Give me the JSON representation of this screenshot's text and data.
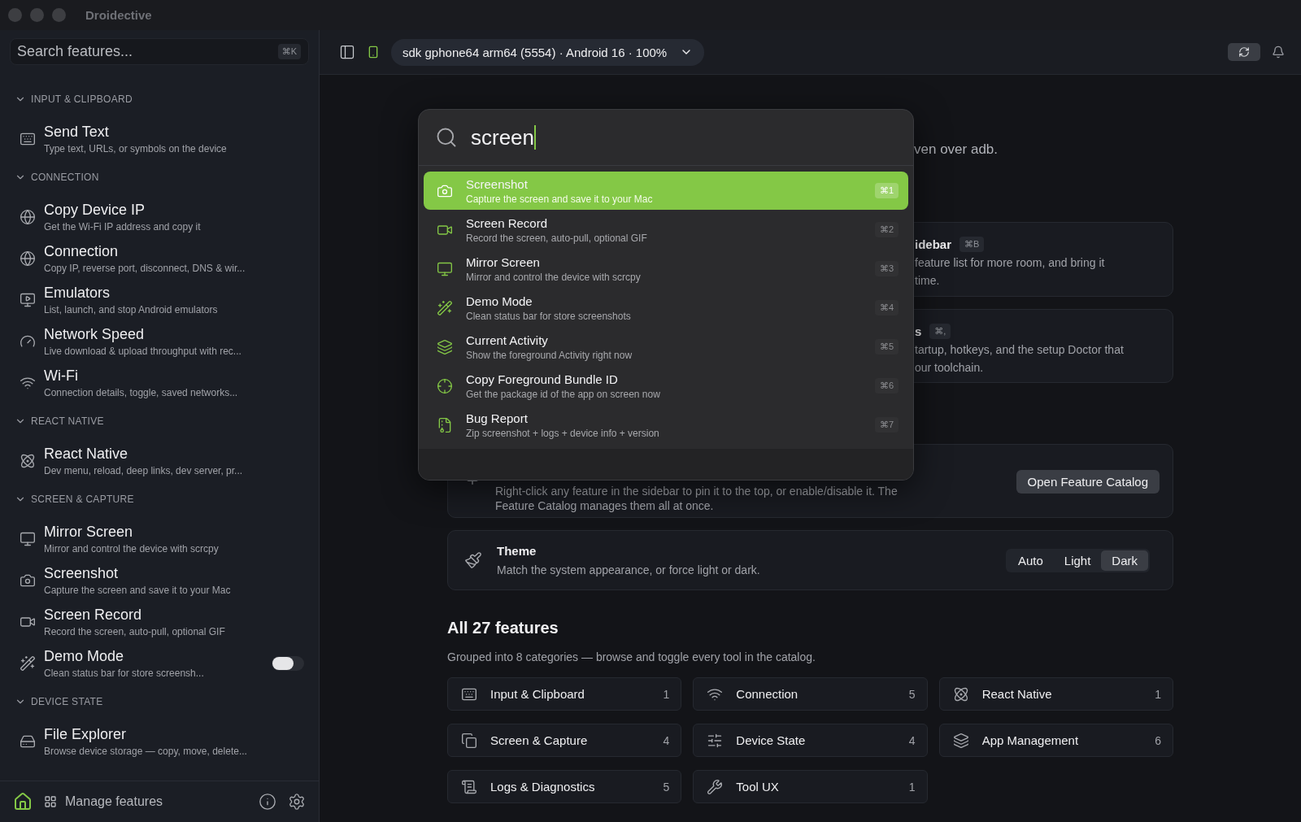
{
  "window": {
    "title": "Droidective"
  },
  "sidebar": {
    "search": {
      "placeholder": "Search features...",
      "shortcut": "⌘K"
    },
    "sections": [
      {
        "title": "INPUT & CLIPBOARD",
        "expanded": true,
        "items": [
          {
            "kind": "plain",
            "title": "Send Text",
            "description": "Type text, URLs, or symbols on the device"
          }
        ]
      },
      {
        "title": "CONNECTION",
        "expanded": true,
        "items": [
          {
            "kind": "plain",
            "title": "Copy Device IP",
            "description": "Get the Wi-Fi IP address and copy it"
          },
          {
            "kind": "plain",
            "title": "Connection",
            "description": "Copy IP, reverse port, disconnect, DNS & wir..."
          },
          {
            "kind": "plain",
            "title": "Emulators",
            "description": "List, launch, and stop Android emulators"
          },
          {
            "kind": "plain",
            "title": "Network Speed",
            "description": "Live download & upload throughput with rec..."
          },
          {
            "kind": "plain",
            "title": "Wi-Fi",
            "description": "Connection details, toggle, saved networks..."
          }
        ]
      },
      {
        "title": "REACT NATIVE",
        "expanded": true,
        "items": [
          {
            "kind": "plain",
            "title": "React Native",
            "description": "Dev menu, reload, deep links, dev server, pr..."
          }
        ]
      },
      {
        "title": "SCREEN & CAPTURE",
        "expanded": true,
        "items": [
          {
            "kind": "plain",
            "title": "Mirror Screen",
            "description": "Mirror and control the device with scrcpy"
          },
          {
            "kind": "plain",
            "title": "Screenshot",
            "description": "Capture the screen and save it to your Mac"
          },
          {
            "kind": "plain",
            "title": "Screen Record",
            "description": "Record the screen, auto-pull, optional GIF"
          },
          {
            "kind": "toggle",
            "on": false,
            "title": "Demo Mode",
            "description": "Clean status bar for store screensh..."
          }
        ]
      },
      {
        "title": "DEVICE STATE",
        "expanded": true,
        "items": [
          {
            "kind": "plain",
            "title": "File Explorer",
            "description": "Browse device storage — copy, move, delete..."
          }
        ]
      }
    ],
    "footer": {
      "manage_label": "Manage features"
    }
  },
  "toolbar": {
    "device": "sdk gphone64 arm64 (5554) · Android 16 · 100%"
  },
  "palette": {
    "query": "screen",
    "results": [
      {
        "title": "Screenshot",
        "description": "Capture the screen and save it to your Mac",
        "shortcut": "⌘1",
        "selected": true
      },
      {
        "title": "Screen Record",
        "description": "Record the screen, auto-pull, optional GIF",
        "shortcut": "⌘2",
        "selected": false
      },
      {
        "title": "Mirror Screen",
        "description": "Mirror and control the device with scrcpy",
        "shortcut": "⌘3",
        "selected": false
      },
      {
        "title": "Demo Mode",
        "description": "Clean status bar for store screenshots",
        "shortcut": "⌘4",
        "selected": false
      },
      {
        "title": "Current Activity",
        "description": "Show the foreground Activity right now",
        "shortcut": "⌘5",
        "selected": false
      },
      {
        "title": "Copy Foreground Bundle ID",
        "description": "Get the package id of the app on screen now",
        "shortcut": "⌘6",
        "selected": false
      },
      {
        "title": "Bug Report",
        "description": "Zip screenshot + logs + device info + version",
        "shortcut": "⌘7",
        "selected": false
      }
    ]
  },
  "main": {
    "intro_fragment": "ven over adb.",
    "tips": [
      {
        "title_fragment": "idebar",
        "shortcut": "⌘B",
        "lines": [
          "feature list for more room, and bring it",
          "time."
        ]
      },
      {
        "title_fragment": "s",
        "shortcut": "⌘,",
        "lines": [
          "tartup, hotkeys, and the setup Doctor that",
          "our toolchain."
        ]
      }
    ],
    "catalog_tip": {
      "lines": [
        "Right-click any feature in the sidebar to pin it to the top, or enable/disable it. The",
        "Feature Catalog manages them all at once."
      ],
      "button": "Open Feature Catalog"
    },
    "theme": {
      "title": "Theme",
      "description": "Match the system appearance, or force light or dark.",
      "options": [
        {
          "label": "Auto",
          "selected": false
        },
        {
          "label": "Light",
          "selected": false
        },
        {
          "label": "Dark",
          "selected": true
        }
      ]
    },
    "features": {
      "title": "All 27 features",
      "subtitle": "Grouped into 8 categories — browse and toggle every tool in the catalog.",
      "categories": [
        {
          "name": "Input & Clipboard",
          "count": "1"
        },
        {
          "name": "Connection",
          "count": "5"
        },
        {
          "name": "React Native",
          "count": "1"
        },
        {
          "name": "Screen & Capture",
          "count": "4"
        },
        {
          "name": "Device State",
          "count": "4"
        },
        {
          "name": "App Management",
          "count": "6"
        },
        {
          "name": "Logs & Diagnostics",
          "count": "5"
        },
        {
          "name": "Tool UX",
          "count": "1"
        }
      ]
    }
  }
}
